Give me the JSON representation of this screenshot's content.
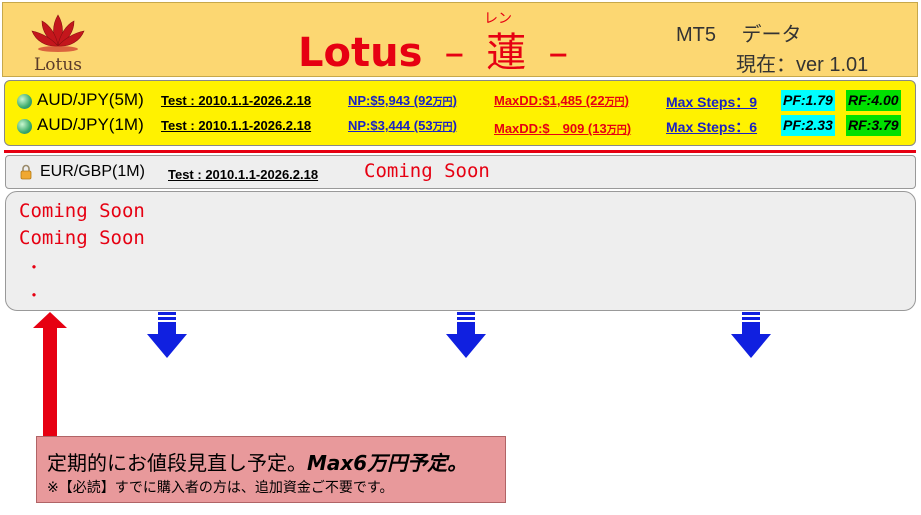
{
  "header": {
    "logo_text": "Lotus",
    "title_latin": "Lotus",
    "title_sep1": "–",
    "title_kanji": "蓮",
    "title_sep2": "–",
    "title_ruby": "レン",
    "mt5": "MT5　 データ",
    "version": "現在：ver 1.01"
  },
  "rows": [
    {
      "pair": "AUD/JPY(5M)",
      "test": "Test : 2010.1.1-2026.2.18",
      "np": "NP:$5,943 (92",
      "np_unit": "万円",
      "np_close": ")",
      "maxdd": "MaxDD:$1,485 (22",
      "maxdd_unit": "万円",
      "maxdd_close": ")",
      "steps": "Max Steps：9",
      "pf": "PF:1.79",
      "rf": "RF:4.00"
    },
    {
      "pair": "AUD/JPY(1M)",
      "test": "Test : 2010.1.1-2026.2.18",
      "np": "NP:$3,444 (53",
      "np_unit": "万円",
      "np_close": ")",
      "maxdd": "MaxDD:$　909 (13",
      "maxdd_unit": "万円",
      "maxdd_close": ")",
      "steps": "Max Steps：6",
      "pf": "PF:2.33",
      "rf": "RF:3.79"
    }
  ],
  "eur": {
    "pair": "EUR/GBP(1M)",
    "test": "Test : 2010.1.1-2026.2.18",
    "coming": "Coming Soon"
  },
  "box": {
    "line1": "Coming Soon",
    "line2": "Coming Soon",
    "bullet1": "・",
    "bullet2": "・"
  },
  "notice": {
    "line1_plain": "定期的にお値段見直し予定。",
    "line1_bold": "Max6万円予定。",
    "line2": "※【必読】すでに購入者の方は、追加資金ご不要です。"
  },
  "colors": {
    "header_bg": "#fcd772",
    "accent_red": "#e60012",
    "row_bg": "#fff200",
    "link_blue": "#1a22c4",
    "pf_bg": "#00ffff",
    "rf_bg": "#00e000",
    "arrow_blue": "#1020e0",
    "notice_bg": "#e8999b"
  },
  "icons": {
    "logo": "lotus-flower-icon",
    "row_marker": "globe-icon",
    "lock": "lock-icon",
    "up_arrow": "red-up-arrow-icon",
    "down_arrow": "blue-down-arrow-icon"
  }
}
